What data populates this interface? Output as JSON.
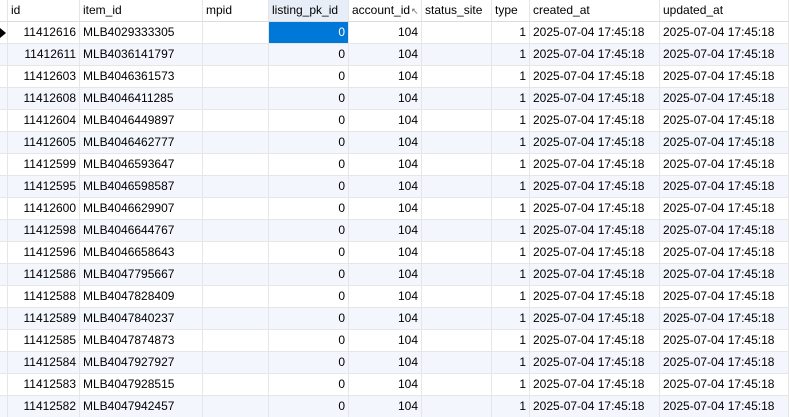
{
  "columns": [
    {
      "key": "id",
      "label": "id"
    },
    {
      "key": "item_id",
      "label": "item_id"
    },
    {
      "key": "mpid",
      "label": "mpid"
    },
    {
      "key": "listing_pk_id",
      "label": "listing_pk_id"
    },
    {
      "key": "account_id",
      "label": "account_id"
    },
    {
      "key": "status_site",
      "label": "status_site"
    },
    {
      "key": "type",
      "label": "type"
    },
    {
      "key": "created_at",
      "label": "created_at"
    },
    {
      "key": "updated_at",
      "label": "updated_at"
    }
  ],
  "rows": [
    {
      "id": "11412616",
      "item_id": "MLB4029333305",
      "mpid": "",
      "listing_pk_id": "0",
      "account_id": "104",
      "status_site": "",
      "type": "1",
      "created_at": "2025-07-04 17:45:18",
      "updated_at": "2025-07-04 17:45:18"
    },
    {
      "id": "11412611",
      "item_id": "MLB4036141797",
      "mpid": "",
      "listing_pk_id": "0",
      "account_id": "104",
      "status_site": "",
      "type": "1",
      "created_at": "2025-07-04 17:45:18",
      "updated_at": "2025-07-04 17:45:18"
    },
    {
      "id": "11412603",
      "item_id": "MLB4046361573",
      "mpid": "",
      "listing_pk_id": "0",
      "account_id": "104",
      "status_site": "",
      "type": "1",
      "created_at": "2025-07-04 17:45:18",
      "updated_at": "2025-07-04 17:45:18"
    },
    {
      "id": "11412608",
      "item_id": "MLB4046411285",
      "mpid": "",
      "listing_pk_id": "0",
      "account_id": "104",
      "status_site": "",
      "type": "1",
      "created_at": "2025-07-04 17:45:18",
      "updated_at": "2025-07-04 17:45:18"
    },
    {
      "id": "11412604",
      "item_id": "MLB4046449897",
      "mpid": "",
      "listing_pk_id": "0",
      "account_id": "104",
      "status_site": "",
      "type": "1",
      "created_at": "2025-07-04 17:45:18",
      "updated_at": "2025-07-04 17:45:18"
    },
    {
      "id": "11412605",
      "item_id": "MLB4046462777",
      "mpid": "",
      "listing_pk_id": "0",
      "account_id": "104",
      "status_site": "",
      "type": "1",
      "created_at": "2025-07-04 17:45:18",
      "updated_at": "2025-07-04 17:45:18"
    },
    {
      "id": "11412599",
      "item_id": "MLB4046593647",
      "mpid": "",
      "listing_pk_id": "0",
      "account_id": "104",
      "status_site": "",
      "type": "1",
      "created_at": "2025-07-04 17:45:18",
      "updated_at": "2025-07-04 17:45:18"
    },
    {
      "id": "11412595",
      "item_id": "MLB4046598587",
      "mpid": "",
      "listing_pk_id": "0",
      "account_id": "104",
      "status_site": "",
      "type": "1",
      "created_at": "2025-07-04 17:45:18",
      "updated_at": "2025-07-04 17:45:18"
    },
    {
      "id": "11412600",
      "item_id": "MLB4046629907",
      "mpid": "",
      "listing_pk_id": "0",
      "account_id": "104",
      "status_site": "",
      "type": "1",
      "created_at": "2025-07-04 17:45:18",
      "updated_at": "2025-07-04 17:45:18"
    },
    {
      "id": "11412598",
      "item_id": "MLB4046644767",
      "mpid": "",
      "listing_pk_id": "0",
      "account_id": "104",
      "status_site": "",
      "type": "1",
      "created_at": "2025-07-04 17:45:18",
      "updated_at": "2025-07-04 17:45:18"
    },
    {
      "id": "11412596",
      "item_id": "MLB4046658643",
      "mpid": "",
      "listing_pk_id": "0",
      "account_id": "104",
      "status_site": "",
      "type": "1",
      "created_at": "2025-07-04 17:45:18",
      "updated_at": "2025-07-04 17:45:18"
    },
    {
      "id": "11412586",
      "item_id": "MLB4047795667",
      "mpid": "",
      "listing_pk_id": "0",
      "account_id": "104",
      "status_site": "",
      "type": "1",
      "created_at": "2025-07-04 17:45:18",
      "updated_at": "2025-07-04 17:45:18"
    },
    {
      "id": "11412588",
      "item_id": "MLB4047828409",
      "mpid": "",
      "listing_pk_id": "0",
      "account_id": "104",
      "status_site": "",
      "type": "1",
      "created_at": "2025-07-04 17:45:18",
      "updated_at": "2025-07-04 17:45:18"
    },
    {
      "id": "11412589",
      "item_id": "MLB4047840237",
      "mpid": "",
      "listing_pk_id": "0",
      "account_id": "104",
      "status_site": "",
      "type": "1",
      "created_at": "2025-07-04 17:45:18",
      "updated_at": "2025-07-04 17:45:18"
    },
    {
      "id": "11412585",
      "item_id": "MLB4047874873",
      "mpid": "",
      "listing_pk_id": "0",
      "account_id": "104",
      "status_site": "",
      "type": "1",
      "created_at": "2025-07-04 17:45:18",
      "updated_at": "2025-07-04 17:45:18"
    },
    {
      "id": "11412584",
      "item_id": "MLB4047927927",
      "mpid": "",
      "listing_pk_id": "0",
      "account_id": "104",
      "status_site": "",
      "type": "1",
      "created_at": "2025-07-04 17:45:18",
      "updated_at": "2025-07-04 17:45:18"
    },
    {
      "id": "11412583",
      "item_id": "MLB4047928515",
      "mpid": "",
      "listing_pk_id": "0",
      "account_id": "104",
      "status_site": "",
      "type": "1",
      "created_at": "2025-07-04 17:45:18",
      "updated_at": "2025-07-04 17:45:18"
    },
    {
      "id": "11412582",
      "item_id": "MLB4047942457",
      "mpid": "",
      "listing_pk_id": "0",
      "account_id": "104",
      "status_site": "",
      "type": "1",
      "created_at": "2025-07-04 17:45:18",
      "updated_at": "2025-07-04 17:45:18"
    }
  ],
  "selection": {
    "row": 0,
    "column": "listing_pk_id"
  },
  "colors": {
    "selected_bg": "#0078d7",
    "alt_row_bg": "#f3f7fd",
    "header_sorted_bg": "#e8eef8"
  },
  "icons": {
    "current_row_marker": "triangle-right-icon",
    "header_cursor": "pointer-cursor-icon"
  }
}
